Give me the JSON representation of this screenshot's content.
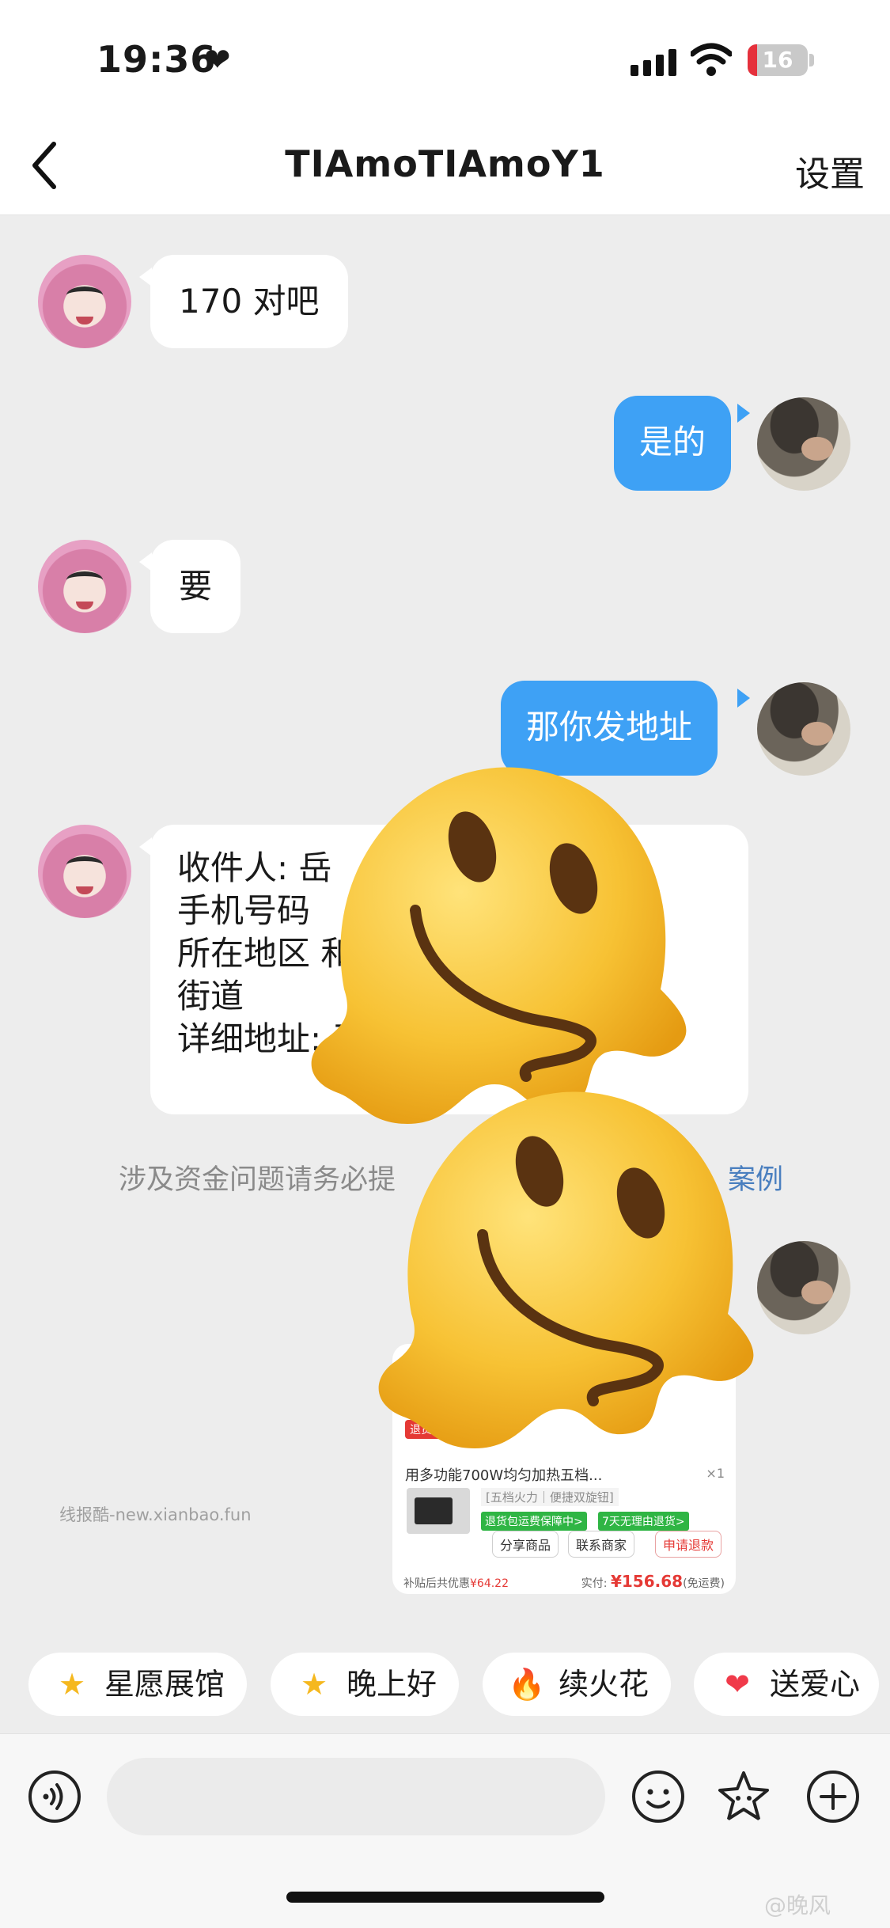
{
  "status_bar": {
    "time": "19:36",
    "battery_level": "16",
    "battery_fraction": 0.16,
    "battery_color": "#e5313c"
  },
  "nav": {
    "title": "TIAmoTIAmoY1",
    "settings_label": "设置",
    "back_icon": "chevron-left-icon"
  },
  "messages": [
    {
      "side": "in",
      "text": "170 对吧"
    },
    {
      "side": "out",
      "text": "是的"
    },
    {
      "side": "in",
      "text": "要"
    },
    {
      "side": "out",
      "text": "那你发地址"
    },
    {
      "side": "in",
      "lines": [
        "收件人: 岳",
        "手机号码",
        "所在地区                                 和",
        "街道",
        "详细地址: 无                       区"
      ]
    }
  ],
  "notice": {
    "text": "涉及资金问题请务必提",
    "link": "案例"
  },
  "order_card": {
    "tag": "退货包",
    "product_title": "用多功能700W均匀加热五档...",
    "qty": "×1",
    "spec": "[五档火力｜便捷双旋钮]",
    "badges": [
      "退货包运费保障中>",
      "7天无理由退货>"
    ],
    "actions": [
      "分享商品",
      "联系商家",
      "申请退款"
    ],
    "subsidy_label": "补贴后共优惠",
    "subsidy_value": "¥64.22",
    "paid_label": "实付:",
    "paid_value": "¥156.68",
    "shipping": "(免运费)"
  },
  "watermark": "线报酷-new.xianbao.fun",
  "stickers": [
    "melting-face-emoji",
    "melting-face-emoji"
  ],
  "quick_replies": [
    {
      "icon": "star-icon",
      "glyph": "★",
      "label": "星愿展馆"
    },
    {
      "icon": "star-icon",
      "glyph": "★",
      "label": "晚上好"
    },
    {
      "icon": "fire-icon",
      "glyph": "🔥",
      "label": "续火花"
    },
    {
      "icon": "heart-icon",
      "glyph": "❤",
      "label": "送爱心"
    }
  ],
  "input": {
    "placeholder": ""
  },
  "bottom_icons": [
    "voice-icon",
    "emoji-icon",
    "sticker-icon",
    "plus-icon"
  ],
  "corner_mark": "@晚风",
  "colors": {
    "accent": "#3ea1f5",
    "background": "#ededed",
    "bubble_in": "#ffffff",
    "sticker": "#f7c234"
  }
}
